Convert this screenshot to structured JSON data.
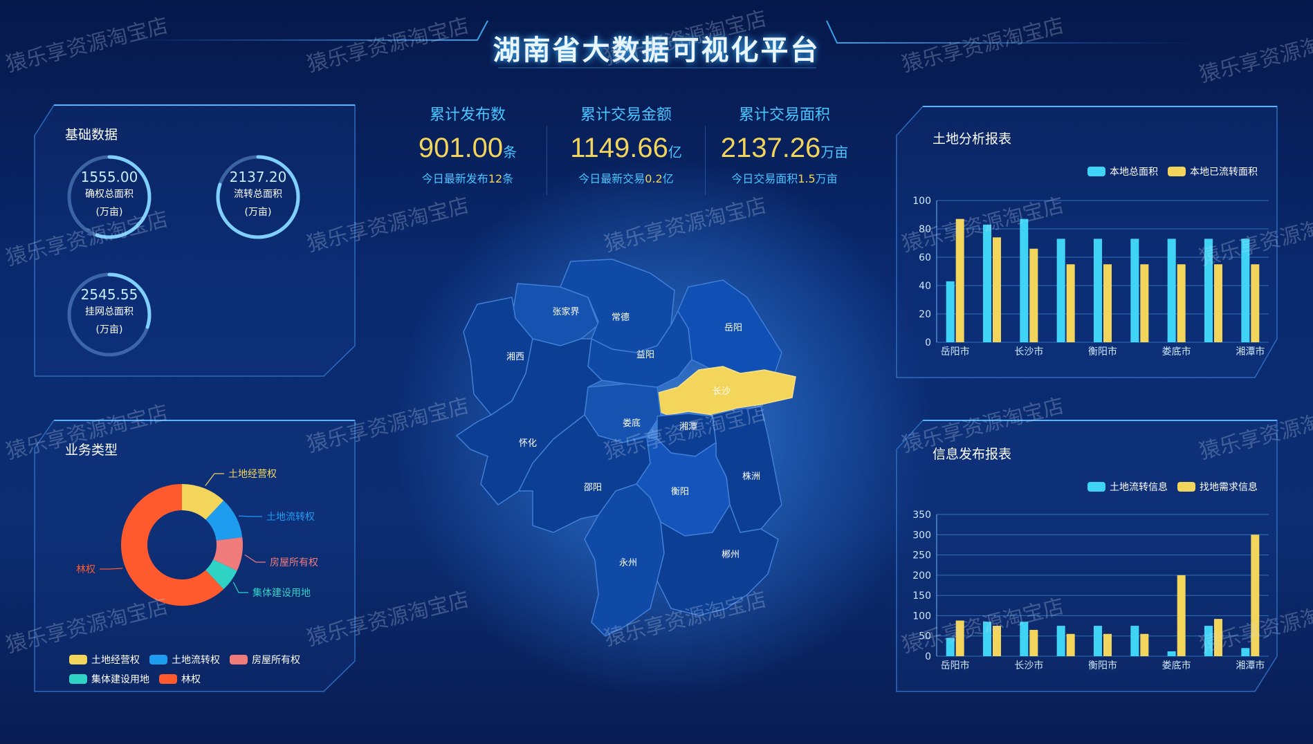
{
  "title": "湖南省大数据可视化平台",
  "watermark": "猿乐享资源淘宝店",
  "basic_data": {
    "title": "基础数据",
    "items": [
      {
        "value": "1555.00",
        "label": "确权总面积",
        "unit": "(万亩)",
        "progress": 0.55
      },
      {
        "value": "2137.20",
        "label": "流转总面积",
        "unit": "(万亩)",
        "progress": 0.8
      },
      {
        "value": "2545.55",
        "label": "挂网总面积",
        "unit": "(万亩)",
        "progress": 0.3
      }
    ]
  },
  "kpis": [
    {
      "title": "累计发布数",
      "value": "901.00",
      "unit": "条",
      "sub_prefix": "今日最新发布",
      "sub_value": "12",
      "sub_suffix": "条"
    },
    {
      "title": "累计交易金额",
      "value": "1149.66",
      "unit": "亿",
      "sub_prefix": "今日最新交易",
      "sub_value": "0.2",
      "sub_suffix": "亿"
    },
    {
      "title": "累计交易面积",
      "value": "2137.26",
      "unit": "万亩",
      "sub_prefix": "今日交易面积",
      "sub_value": "1.5",
      "sub_suffix": "万亩"
    }
  ],
  "map": {
    "highlighted": "长沙",
    "highlight_color": "#f3d55b",
    "regions": [
      "张家界",
      "常德",
      "岳阳",
      "湘西",
      "益阳",
      "长沙",
      "娄底",
      "湘潭",
      "怀化",
      "株洲",
      "邵阳",
      "衡阳",
      "永州",
      "郴州"
    ]
  },
  "colors": {
    "cyan": "#3fd4f5",
    "yellow": "#f3d55b",
    "pie": [
      "#f3d55b",
      "#1e9cf0",
      "#f07b7b",
      "#2fd3c5",
      "#ff5a2e"
    ]
  },
  "business": {
    "title": "业务类型",
    "chart_data": {
      "type": "pie",
      "donut": true,
      "labels": [
        "土地经营权",
        "土地流转权",
        "房屋所有权",
        "集体建设用地",
        "林权"
      ],
      "values": [
        12,
        11,
        9,
        6,
        62
      ],
      "legend_position": "bottom"
    }
  },
  "land_chart": {
    "title": "土地分析报表",
    "chart_data": {
      "type": "bar",
      "categories": [
        "岳阳市",
        "长沙市",
        "衡阳市",
        "娄底市",
        "湘潭市"
      ],
      "x_slots": 9,
      "series": [
        {
          "name": "本地总面积",
          "values": [
            43,
            83,
            87,
            73,
            73,
            73,
            73,
            73,
            73
          ]
        },
        {
          "name": "本地已流转面积",
          "values": [
            87,
            74,
            66,
            55,
            55,
            55,
            55,
            55,
            55
          ]
        }
      ],
      "ylim": [
        0,
        100
      ],
      "yticks": [
        0,
        20,
        40,
        60,
        80,
        100
      ],
      "grid": true,
      "legend_position": "top-right"
    }
  },
  "info_chart": {
    "title": "信息发布报表",
    "chart_data": {
      "type": "bar",
      "categories": [
        "岳阳市",
        "长沙市",
        "衡阳市",
        "娄底市",
        "湘潭市"
      ],
      "x_slots": 9,
      "series": [
        {
          "name": "土地流转信息",
          "values": [
            45,
            85,
            85,
            75,
            75,
            75,
            12,
            75,
            20
          ]
        },
        {
          "name": "找地需求信息",
          "values": [
            88,
            75,
            65,
            55,
            55,
            55,
            200,
            92,
            300
          ]
        }
      ],
      "ylim": [
        0,
        350
      ],
      "yticks": [
        0,
        50,
        100,
        150,
        200,
        250,
        300,
        350
      ],
      "grid": true,
      "legend_position": "top-right"
    }
  }
}
